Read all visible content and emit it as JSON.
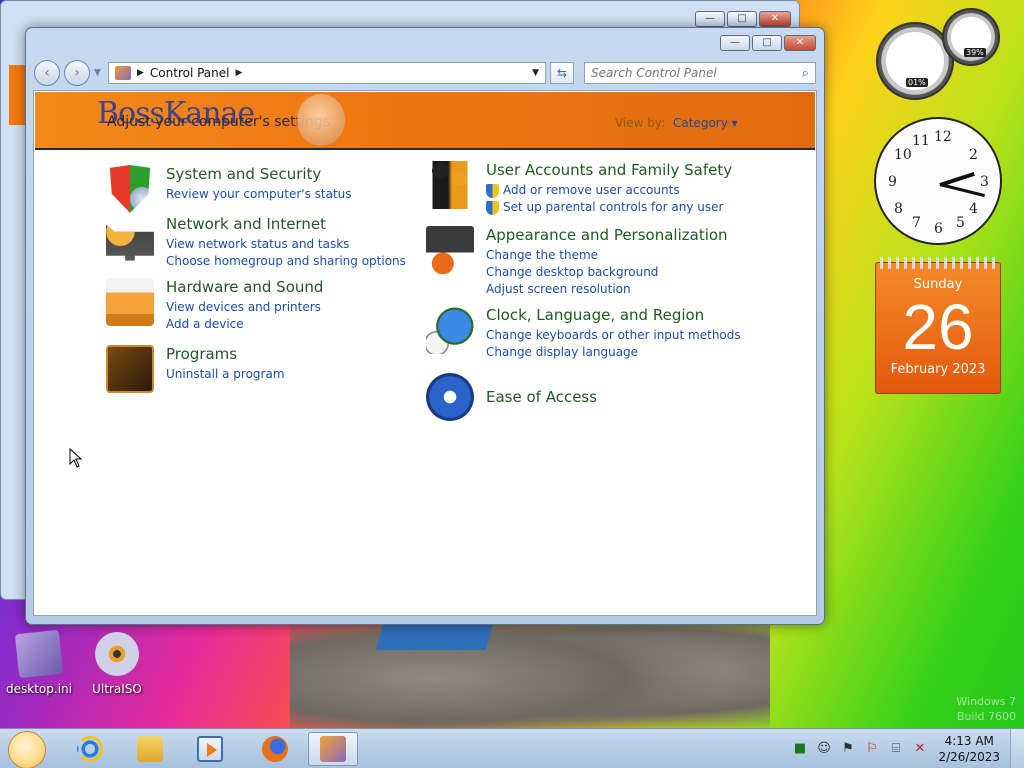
{
  "window": {
    "address_path": "Control Panel",
    "search_placeholder": "Search Control Panel",
    "banner_brand": "BossKanae",
    "heading": "Adjust your computer's settings",
    "view_by_label": "View by:",
    "view_by_value": "Category"
  },
  "categories_left": [
    {
      "icon": "security-shield-icon",
      "title": "System and Security",
      "links": [
        "Review your computer's status"
      ]
    },
    {
      "icon": "network-icon",
      "title": "Network and Internet",
      "links": [
        "View network status and tasks",
        "Choose homegroup and sharing options"
      ]
    },
    {
      "icon": "printer-icon",
      "title": "Hardware and Sound",
      "links": [
        "View devices and printers",
        "Add a device"
      ]
    },
    {
      "icon": "programs-icon",
      "title": "Programs",
      "links": [
        "Uninstall a program"
      ]
    }
  ],
  "categories_right": [
    {
      "icon": "users-icon",
      "title": "User Accounts and Family Safety",
      "links": [
        "Add or remove user accounts",
        "Set up parental controls for any user"
      ]
    },
    {
      "icon": "appearance-icon",
      "title": "Appearance and Personalization",
      "links": [
        "Change the theme",
        "Change desktop background",
        "Adjust screen resolution"
      ]
    },
    {
      "icon": "globe-clock-icon",
      "title": "Clock, Language, and Region",
      "links": [
        "Change keyboards or other input methods",
        "Change display language"
      ]
    },
    {
      "icon": "ease-of-access-icon",
      "title": "Ease of Access",
      "links": []
    }
  ],
  "desktop_icons": [
    {
      "label": "desktop.ini",
      "icon": "ini-file-icon"
    },
    {
      "label": "UltraISO",
      "icon": "disc-icon"
    }
  ],
  "gadgets": {
    "cpu_percent": "01%",
    "memory_percent": "39%",
    "calendar_day": "Sunday",
    "calendar_date": "26",
    "calendar_month": "February 2023"
  },
  "watermark": {
    "line1": "Windows 7",
    "line2": "Build 7600"
  },
  "taskbar": {
    "time": "4:13 AM",
    "date": "2/26/2023"
  },
  "colors": {
    "banner": "#f07812",
    "link": "#1a4ea8",
    "title": "#1e5a1e"
  }
}
